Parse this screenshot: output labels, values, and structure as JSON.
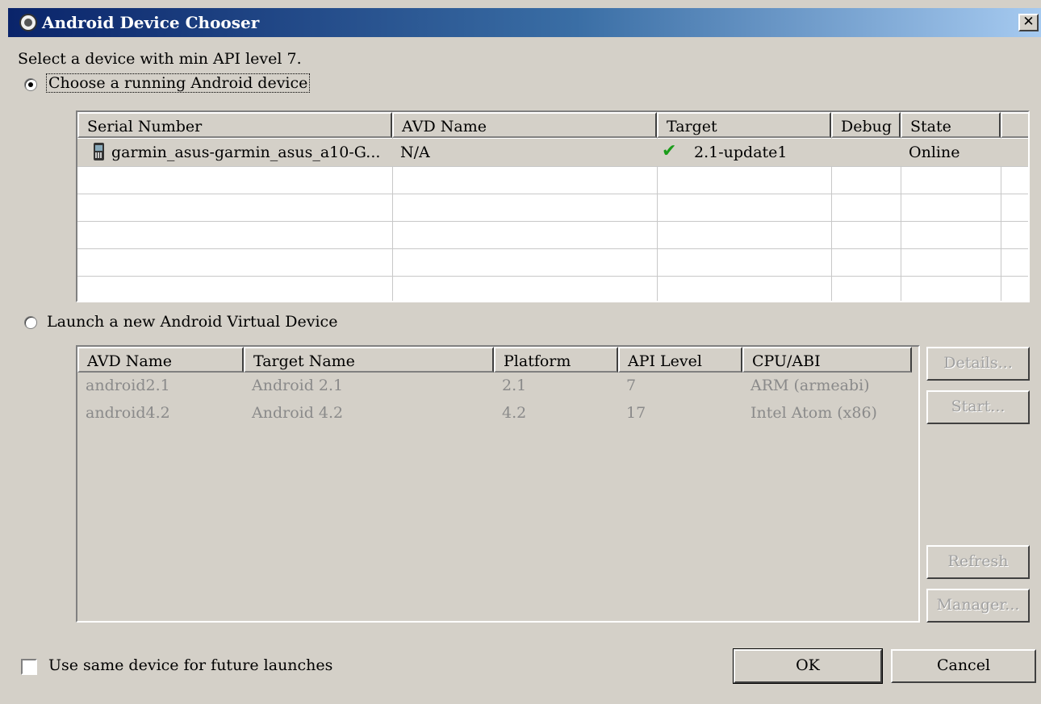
{
  "window": {
    "title": "Android Device Chooser",
    "close_glyph": "✕"
  },
  "prompt": "Select a device with min API level 7.",
  "running": {
    "radio_label": "Choose a running Android device",
    "selected": true,
    "columns": [
      "Serial Number",
      "AVD Name",
      "Target",
      "Debug",
      "State"
    ],
    "rows": [
      {
        "serial": "garmin_asus-garmin_asus_a10-G...",
        "avd_name": "N/A",
        "target": "2.1-update1",
        "target_icon": "check-icon",
        "debug": "",
        "state": "Online",
        "device_icon": "phone-icon"
      }
    ]
  },
  "avd": {
    "radio_label": "Launch a new Android Virtual Device",
    "selected": false,
    "columns": [
      "AVD Name",
      "Target Name",
      "Platform",
      "API Level",
      "CPU/ABI"
    ],
    "rows": [
      {
        "name": "android2.1",
        "target": "Android 2.1",
        "platform": "2.1",
        "api": "7",
        "cpu": "ARM (armeabi)"
      },
      {
        "name": "android4.2",
        "target": "Android 4.2",
        "platform": "4.2",
        "api": "17",
        "cpu": "Intel Atom (x86)"
      }
    ],
    "buttons": {
      "details": "Details...",
      "start": "Start...",
      "refresh": "Refresh",
      "manager": "Manager..."
    }
  },
  "footer": {
    "checkbox_label": "Use same device for future launches",
    "checked": false,
    "ok": "OK",
    "cancel": "Cancel"
  }
}
